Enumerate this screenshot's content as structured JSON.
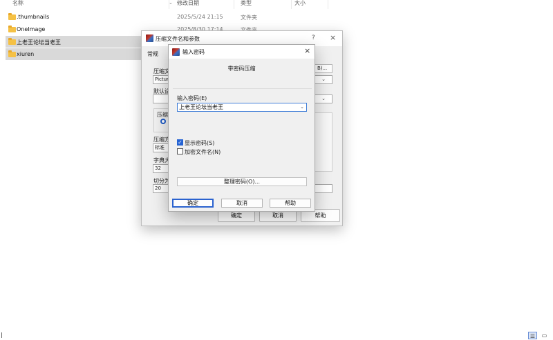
{
  "explorer": {
    "columns": {
      "name": "名称",
      "date": "修改日期",
      "type": "类型",
      "size": "大小"
    },
    "files": [
      {
        "name": ".thumbnails",
        "date": "2025/5/24 21:15",
        "type": "文件夹",
        "selected": false
      },
      {
        "name": "OneImage",
        "date": "2025/8/30 17:14",
        "type": "文件夹",
        "selected": false
      },
      {
        "name": "上老王论坛当老王",
        "date": "",
        "type": "",
        "selected": true
      },
      {
        "name": "xiuren",
        "date": "",
        "type": "",
        "selected": true
      }
    ]
  },
  "archive_dialog": {
    "title": "压缩文件名和参数",
    "help_icon": "?",
    "close_icon": "×",
    "tab_general": "常规",
    "label_archive_name": "压缩文",
    "field_archive_name": "Picture",
    "label_default": "默认设",
    "group_format": "压缩文",
    "label_method": "压缩方",
    "field_method": "标准",
    "label_dict": "字典大",
    "field_dict": "32",
    "label_split": "切分为",
    "field_split": "20",
    "browse_btn": "B)...",
    "ok": "确定",
    "cancel": "取消",
    "help": "帮助"
  },
  "password_dialog": {
    "title": "输入密码",
    "heading": "带密码压缩",
    "password_label": "输入密码(E)",
    "password_value": "上老王论坛当老王",
    "show_password": "显示密码(S)",
    "show_password_checked": true,
    "encrypt_names": "加密文件名(N)",
    "encrypt_names_checked": false,
    "organize_button": "整理密码(O)...",
    "ok": "确定",
    "cancel": "取消",
    "help": "帮助"
  },
  "colors": {
    "accent": "#2563d4",
    "folder": "#f5c145",
    "selection": "#d9d9d9",
    "dialog_bg": "#f0f0f0"
  }
}
